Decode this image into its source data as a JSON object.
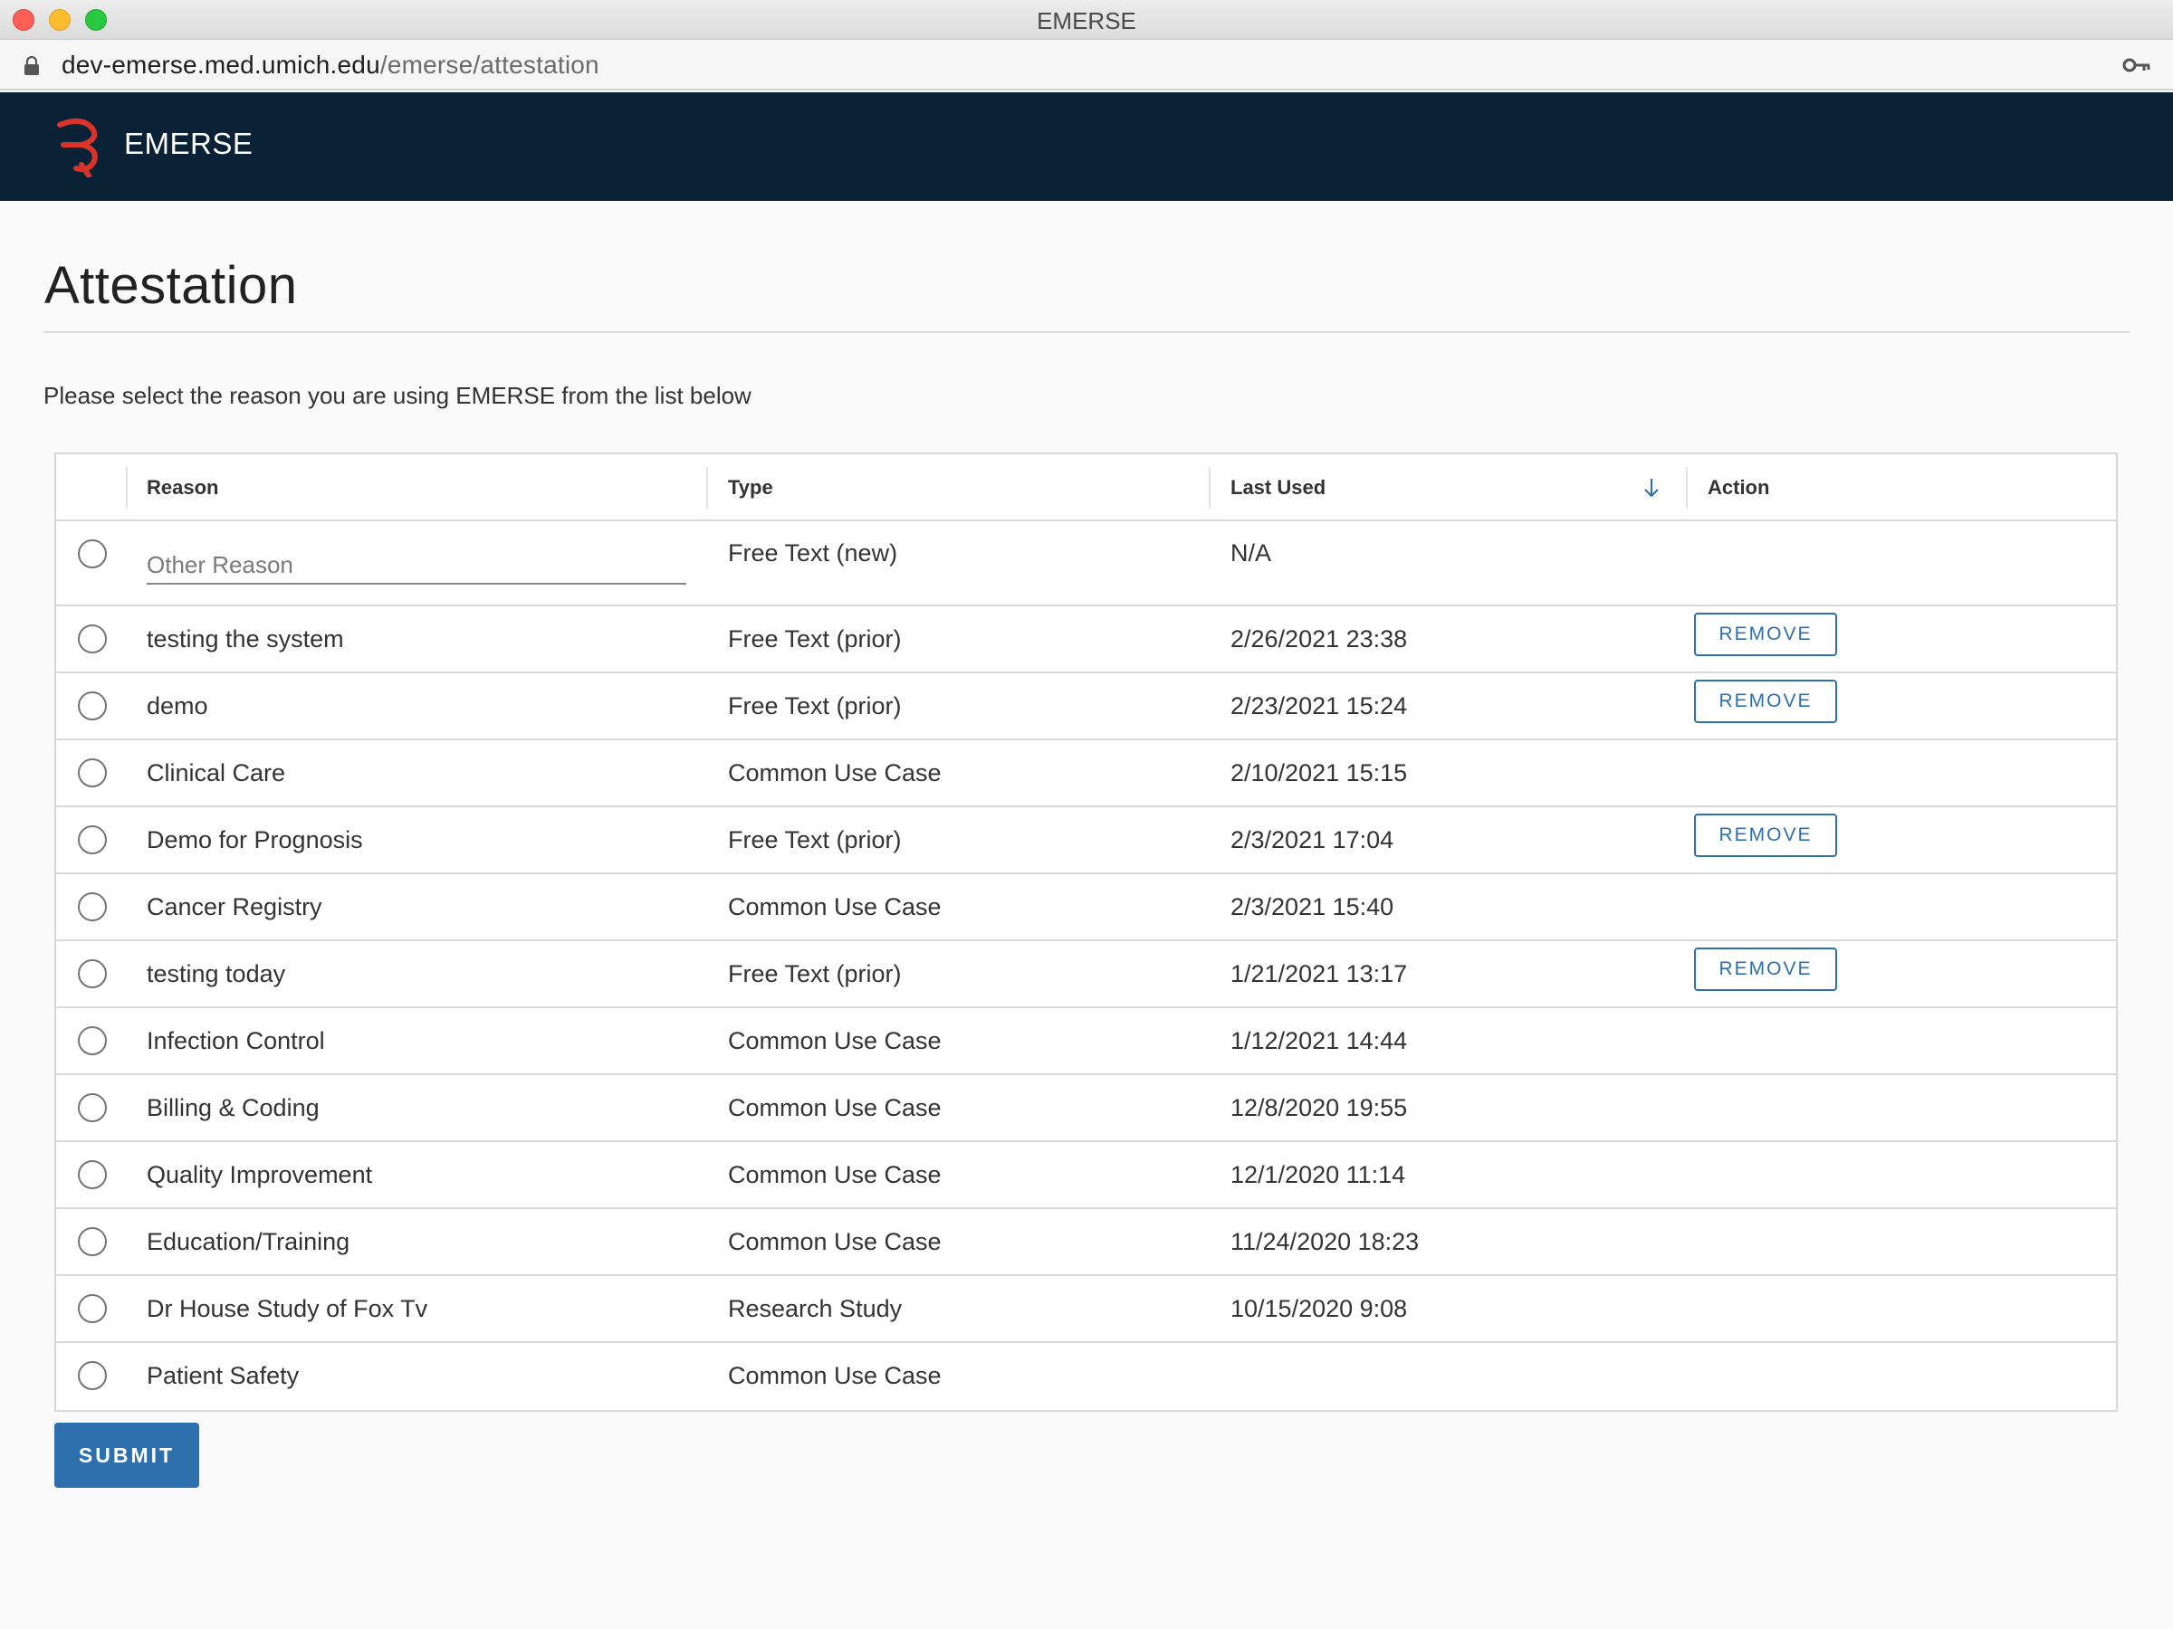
{
  "window": {
    "title": "EMERSE"
  },
  "browser": {
    "url_host": "dev-emerse.med.umich.edu",
    "url_path": "/emerse/attestation"
  },
  "app": {
    "name": "EMERSE"
  },
  "page": {
    "title": "Attestation",
    "instruction": "Please select the reason you are using EMERSE from the list below"
  },
  "table": {
    "headers": {
      "reason": "Reason",
      "type": "Type",
      "last_used": "Last Used",
      "action": "Action"
    },
    "other_row": {
      "placeholder": "Other Reason",
      "value": "",
      "type": "Free Text (new)",
      "last_used": "N/A"
    },
    "rows": [
      {
        "reason": "testing the system",
        "type": "Free Text (prior)",
        "last_used": "2/26/2021 23:38",
        "action": "REMOVE"
      },
      {
        "reason": "demo",
        "type": "Free Text (prior)",
        "last_used": "2/23/2021 15:24",
        "action": "REMOVE"
      },
      {
        "reason": "Clinical Care",
        "type": "Common Use Case",
        "last_used": "2/10/2021 15:15",
        "action": ""
      },
      {
        "reason": "Demo for Prognosis",
        "type": "Free Text (prior)",
        "last_used": "2/3/2021 17:04",
        "action": "REMOVE"
      },
      {
        "reason": "Cancer Registry",
        "type": "Common Use Case",
        "last_used": "2/3/2021 15:40",
        "action": ""
      },
      {
        "reason": "testing today",
        "type": "Free Text (prior)",
        "last_used": "1/21/2021 13:17",
        "action": "REMOVE"
      },
      {
        "reason": "Infection Control",
        "type": "Common Use Case",
        "last_used": "1/12/2021 14:44",
        "action": ""
      },
      {
        "reason": "Billing & Coding",
        "type": "Common Use Case",
        "last_used": "12/8/2020 19:55",
        "action": ""
      },
      {
        "reason": "Quality Improvement",
        "type": "Common Use Case",
        "last_used": "12/1/2020 11:14",
        "action": ""
      },
      {
        "reason": "Education/Training",
        "type": "Common Use Case",
        "last_used": "11/24/2020 18:23",
        "action": ""
      },
      {
        "reason": "Dr House Study of Fox Tv",
        "type": "Research Study",
        "last_used": "10/15/2020 9:08",
        "action": ""
      },
      {
        "reason": "Patient Safety",
        "type": "Common Use Case",
        "last_used": "",
        "action": ""
      }
    ]
  },
  "submit_label": "SUBMIT",
  "colors": {
    "header_bg": "#0b2136",
    "accent": "#2e6fad",
    "logo": "#d9342b"
  }
}
